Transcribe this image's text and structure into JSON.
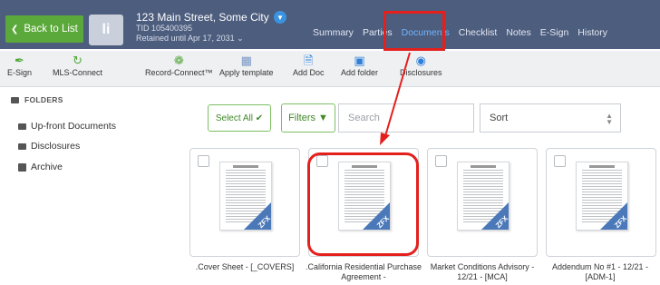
{
  "header": {
    "back_label": "Back to List",
    "prop_thumb_letter": "li",
    "address": "123 Main Street, Some City",
    "tid": "TID 105400395",
    "retained": "Retained until Apr 17, 2031 ⌄",
    "tabs": [
      {
        "label": "Summary"
      },
      {
        "label": "Parties"
      },
      {
        "label": "Documents"
      },
      {
        "label": "Checklist"
      },
      {
        "label": "Notes"
      },
      {
        "label": "E-Sign"
      },
      {
        "label": "History"
      }
    ],
    "active_tab_color": "#6fb4ff"
  },
  "toolbar": {
    "items": [
      {
        "label": "E-Sign",
        "icon": "pen-icon"
      },
      {
        "label": "MLS-Connect",
        "icon": "link-icon"
      },
      {
        "label": "Record-Connect™",
        "icon": "record-icon"
      },
      {
        "label": "Apply template",
        "icon": "grid-icon"
      },
      {
        "label": "Add Doc",
        "icon": "add-doc-icon"
      },
      {
        "label": "Add folder",
        "icon": "add-folder-icon"
      },
      {
        "label": "Disclosures",
        "icon": "disclosures-icon"
      }
    ]
  },
  "sidebar": {
    "heading": "FOLDERS",
    "items": [
      {
        "label": "Up-front Documents"
      },
      {
        "label": "Disclosures"
      },
      {
        "label": "Archive"
      }
    ]
  },
  "filters": {
    "select_all_label": "Select All ✔",
    "filters_label": "Filters",
    "search_placeholder": "Search",
    "sort_label": "Sort"
  },
  "documents": [
    {
      "title": ".Cover Sheet - [_COVERS]",
      "badge": "ZFX"
    },
    {
      "title": ".California Residential Purchase Agreement -",
      "badge": "ZFX"
    },
    {
      "title": "Market Conditions Advisory - 12/21 - [MCA]",
      "badge": "ZFX"
    },
    {
      "title": "Addendum No #1 - 12/21 - [ADM-1]",
      "badge": "ZFX"
    }
  ],
  "colors": {
    "header_bg": "#4d5d7e",
    "back_button": "#5ba93a",
    "highlight": "#e4201d",
    "accent_green": "#3f8a26"
  }
}
